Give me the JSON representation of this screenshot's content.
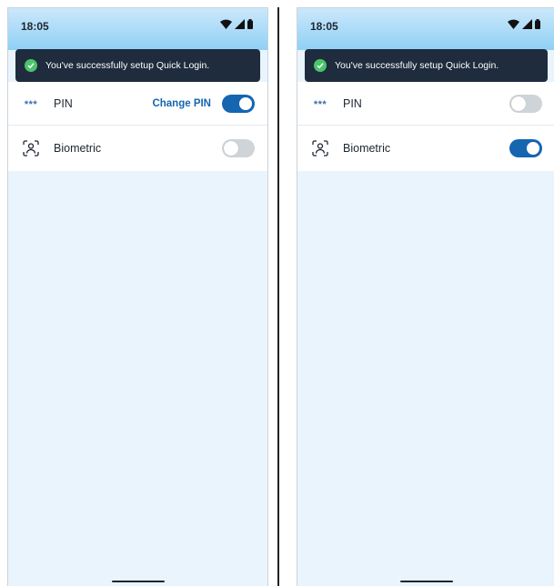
{
  "screens": [
    {
      "status": {
        "time": "18:05"
      },
      "toast": {
        "message": "You've successfully setup Quick Login."
      },
      "pin": {
        "icon_text": "***",
        "label": "PIN",
        "change_label": "Change PIN",
        "enabled": true
      },
      "biometric": {
        "label": "Biometric",
        "enabled": false
      }
    },
    {
      "status": {
        "time": "18:05"
      },
      "toast": {
        "message": "You've successfully setup Quick Login."
      },
      "pin": {
        "icon_text": "***",
        "label": "PIN",
        "enabled": false
      },
      "biometric": {
        "label": "Biometric",
        "enabled": true
      }
    }
  ],
  "icons": {
    "status": [
      "wifi-icon",
      "cellular-signal-icon",
      "battery-icon"
    ],
    "toast": "check-circle-icon",
    "pin": "pin-asterisk-icon",
    "biometric": "face-id-icon"
  },
  "colors": {
    "accent": "#1565b0",
    "toast_bg": "#1e2c3d",
    "success": "#4cc46b",
    "screen_bg": "#eaf4fc"
  }
}
